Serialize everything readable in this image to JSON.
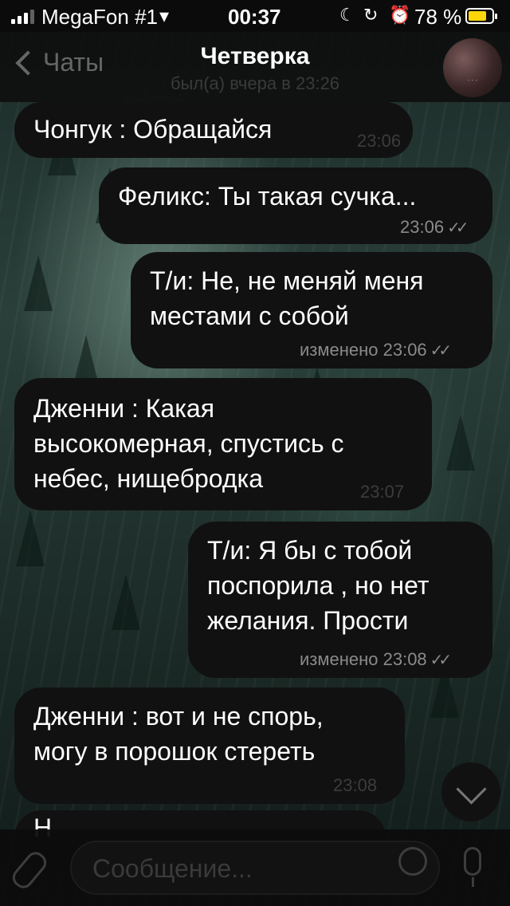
{
  "status_bar": {
    "carrier": "MegaFon #1",
    "time": "00:37",
    "battery_percent": "78 %",
    "battery_level": 0.78
  },
  "header": {
    "back_label": "Чаты",
    "title": "Четверка",
    "subtitle": "был(а) вчера в 23:26"
  },
  "messages": [
    {
      "side": "in",
      "text": "Чонгук : Обращайся",
      "time": "23:06"
    },
    {
      "side": "out",
      "text": "Феликс: Ты такая сучка...",
      "time": "23:06",
      "read": true
    },
    {
      "side": "out",
      "text": "Т/и: Не, не меняй меня\nместами с собой",
      "time": "изменено 23:06",
      "read": true
    },
    {
      "side": "in",
      "text": "Дженни : Какая\nвысокомерная, спустись с\nнебес, нищебродка",
      "time": "23:07"
    },
    {
      "side": "out",
      "text": "Т/и: Я бы с тобой\nпоспорила , но нет\nжелания. Прости",
      "time": "изменено 23:08",
      "read": true
    },
    {
      "side": "in",
      "text": "Дженни : вот и не спорь,\nмогу в порошок стереть",
      "time": "23:08"
    },
    {
      "side": "in",
      "text": "Н",
      "time": ""
    }
  ],
  "composer": {
    "placeholder": "Сообщение..."
  },
  "icons": {
    "back": "chevron-left-icon",
    "attach": "paperclip-icon",
    "sticker": "sticker-icon",
    "mic": "microphone-icon",
    "scroll": "chevron-down-icon"
  },
  "colors": {
    "bubble": "#111112",
    "battery": "#ffd60a"
  }
}
